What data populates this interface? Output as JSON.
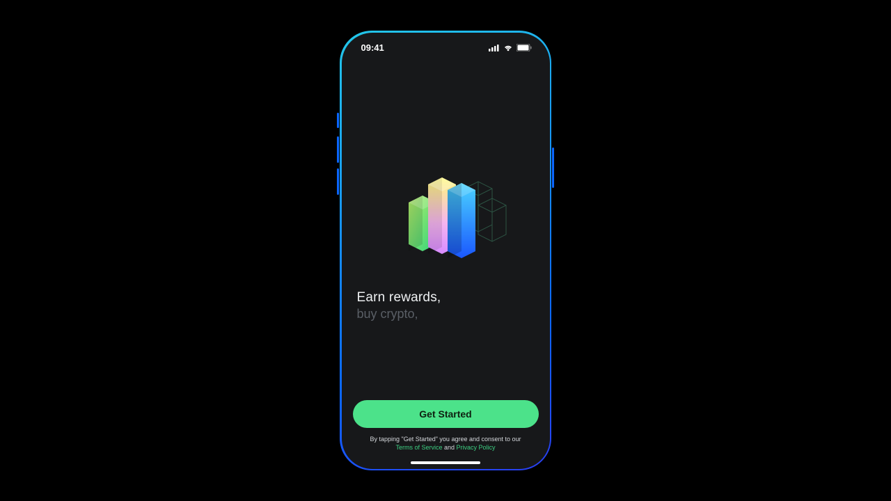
{
  "status": {
    "time": "09:41"
  },
  "hero": {
    "line1": "Earn rewards,",
    "line2": "buy crypto,"
  },
  "cta": {
    "label": "Get Started"
  },
  "legal": {
    "prefix": "By tapping \"Get Started\" you agree and consent to our",
    "tos": "Terms of Service",
    "joiner": " and ",
    "privacy": "Privacy Policy"
  },
  "colors": {
    "accent": "#4ce28a"
  }
}
